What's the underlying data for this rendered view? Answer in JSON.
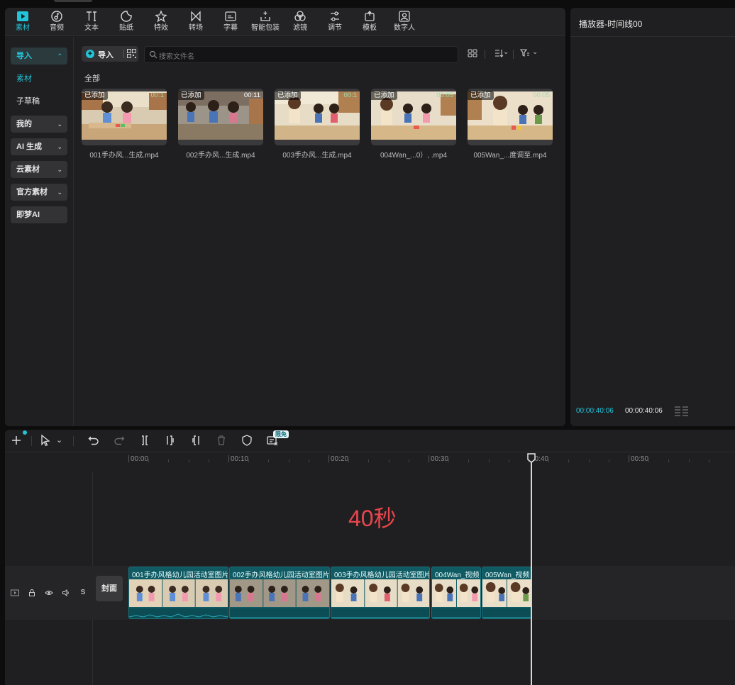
{
  "toolbar": {
    "items": [
      {
        "label": "素材",
        "icon": "media-icon",
        "active": true
      },
      {
        "label": "音频",
        "icon": "audio-icon"
      },
      {
        "label": "文本",
        "icon": "text-icon"
      },
      {
        "label": "贴纸",
        "icon": "sticker-icon"
      },
      {
        "label": "特效",
        "icon": "effects-icon"
      },
      {
        "label": "转场",
        "icon": "transition-icon"
      },
      {
        "label": "字幕",
        "icon": "caption-icon"
      },
      {
        "label": "智能包装",
        "icon": "smart-pack-icon"
      },
      {
        "label": "滤镜",
        "icon": "filter-icon"
      },
      {
        "label": "调节",
        "icon": "adjust-icon"
      },
      {
        "label": "模板",
        "icon": "template-icon"
      },
      {
        "label": "数字人",
        "icon": "avatar-icon"
      }
    ]
  },
  "sidebar": {
    "items": [
      {
        "label": "导入",
        "style": "sel",
        "chevron": "⌃"
      },
      {
        "label": "素材",
        "style": "plain cyan"
      },
      {
        "label": "子草稿",
        "style": "plain"
      },
      {
        "label": "我的",
        "style": "box",
        "chevron": "⌄"
      },
      {
        "label": "AI 生成",
        "style": "box",
        "chevron": "⌄"
      },
      {
        "label": "云素材",
        "style": "box",
        "chevron": "⌄"
      },
      {
        "label": "官方素材",
        "style": "box",
        "chevron": "⌄"
      },
      {
        "label": "即梦AI",
        "style": "box"
      }
    ]
  },
  "media": {
    "import_label": "导入",
    "search_placeholder": "搜索文件名",
    "breadcrumb": "全部",
    "clips": [
      {
        "badge": "已添加",
        "duration": "00:1",
        "name": "001手办风...生成.mp4"
      },
      {
        "badge": "已添加",
        "duration": "00:11",
        "name": "002手办风...生成.mp4"
      },
      {
        "badge": "已添加",
        "duration": "00:1",
        "name": "003手办风...生成.mp4"
      },
      {
        "badge": "已添加",
        "duration": "00:05",
        "name": "004Wan_...0）, .mp4"
      },
      {
        "badge": "已添加",
        "duration": "00:05",
        "name": "005Wan_...度调至.mp4"
      }
    ]
  },
  "player": {
    "title": "播放器-时间线00",
    "current_time": "00:00:40:06",
    "total_time": "00:00:40:06"
  },
  "timeline": {
    "free_badge": "限免",
    "ruler_labels": [
      "00:00",
      "00:10",
      "00:20",
      "00:30",
      "00:40",
      "00:50"
    ],
    "overlay_text": "40秒",
    "cover_label": "封面",
    "track_icons": [
      "▢",
      "🔒",
      "👁",
      "🔈",
      "S"
    ],
    "clips": [
      {
        "title": "001手办风格幼儿园活动室图片"
      },
      {
        "title": "002手办风格幼儿园活动室图片"
      },
      {
        "title": "003手办风格幼儿园活动室图片"
      },
      {
        "title": "004Wan_视频"
      },
      {
        "title": "005Wan_视频"
      }
    ]
  },
  "colors": {
    "accent": "#22c4d8",
    "overlay_red": "#e8464c",
    "clip_teal": "#0f5a63"
  }
}
